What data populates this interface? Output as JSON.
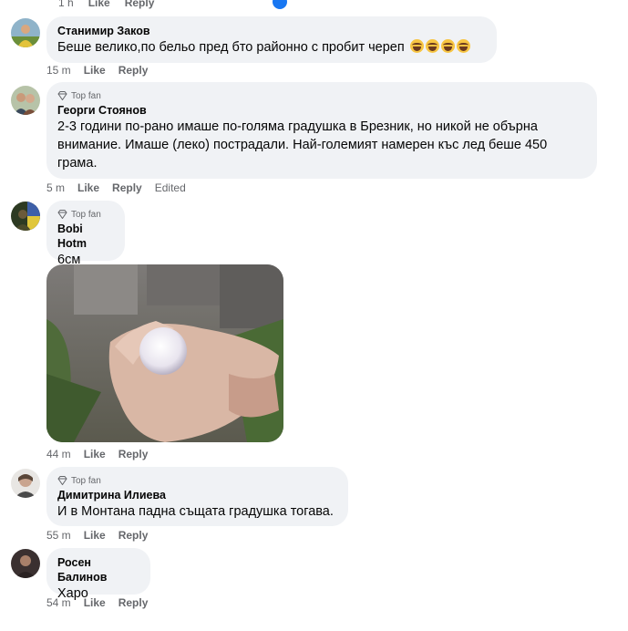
{
  "top_meta": {
    "time": "1 h",
    "like": "Like",
    "reply": "Reply"
  },
  "comments": [
    {
      "name": "Станимир Заков",
      "text": "Беше велико,по бельо пред бто районно с пробит череп",
      "emojis": [
        "rolling-laughing-emoji",
        "rolling-laughing-emoji",
        "rolling-laughing-emoji",
        "rolling-laughing-emoji"
      ],
      "time": "15 m",
      "like": "Like",
      "reply": "Reply"
    },
    {
      "badge": "Top fan",
      "name": "Георги Стоянов",
      "text_lines": [
        "2-3 години по-рано имаше по-голяма градушка в Брезник, но никой не обърна",
        "внимание. Имаше (леко) пострадали. Най-големият намерен къс лед беше 450",
        "грама."
      ],
      "time": "5 m",
      "like": "Like",
      "reply": "Reply",
      "edited": "Edited"
    },
    {
      "badge": "Top fan",
      "name": "Bobi Hotm",
      "text": "6см",
      "photo": "hailstone-in-hand-photo",
      "time": "44 m",
      "like": "Like",
      "reply": "Reply"
    },
    {
      "badge": "Top fan",
      "name": "Димитрина Илиева",
      "text": "И в Монтана падна същата градушка тогава.",
      "time": "55 m",
      "like": "Like",
      "reply": "Reply"
    },
    {
      "name": "Росен Балинов",
      "text": "Харо",
      "time": "54 m",
      "like": "Like",
      "reply": "Reply"
    }
  ],
  "colors": {
    "bubble": "#f0f2f5",
    "meta_text": "#65676b",
    "name_text": "#050505"
  }
}
